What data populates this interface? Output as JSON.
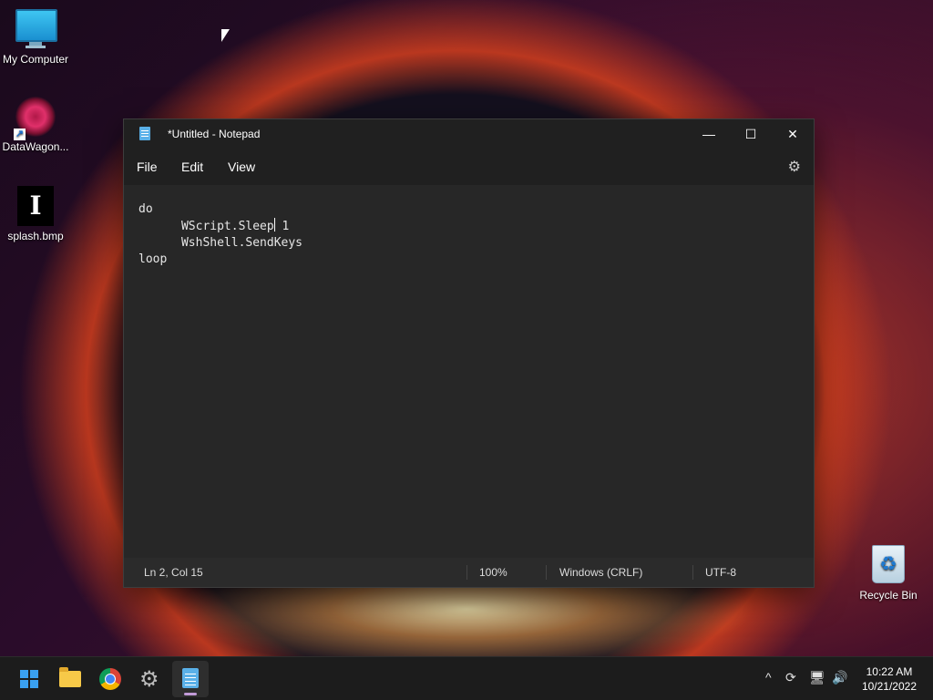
{
  "desktop": {
    "icons": [
      {
        "label": "My Computer"
      },
      {
        "label": "DataWagon..."
      },
      {
        "label": "splash.bmp"
      },
      {
        "label": "Recycle Bin"
      }
    ]
  },
  "window": {
    "title": "*Untitled - Notepad",
    "controls": {
      "minimize": "—",
      "maximize": "☐",
      "close": "✕"
    },
    "menu": [
      "File",
      "Edit",
      "View"
    ],
    "settings_icon": "⚙",
    "editor": {
      "lines": [
        "do",
        "      WScript.Sleep",
        " 1",
        "      WshShell.SendKeys",
        "loop"
      ]
    },
    "status": {
      "position": "Ln 2, Col 15",
      "zoom": "100%",
      "line_ending": "Windows (CRLF)",
      "encoding": "UTF-8"
    }
  },
  "taskbar": {
    "items": [
      "start",
      "file-explorer",
      "chrome",
      "settings",
      "notepad"
    ],
    "active": "notepad",
    "tray": {
      "chevron": "^",
      "sync": "⟳",
      "network": "🖥",
      "volume": "🔊"
    },
    "clock": {
      "time": "10:22 AM",
      "date": "10/21/2022"
    }
  },
  "colors": {
    "accent": "#3aa0f0",
    "window_bg": "#272727",
    "titlebar_bg": "#202020",
    "taskbar_bg": "#1c1c1c"
  }
}
